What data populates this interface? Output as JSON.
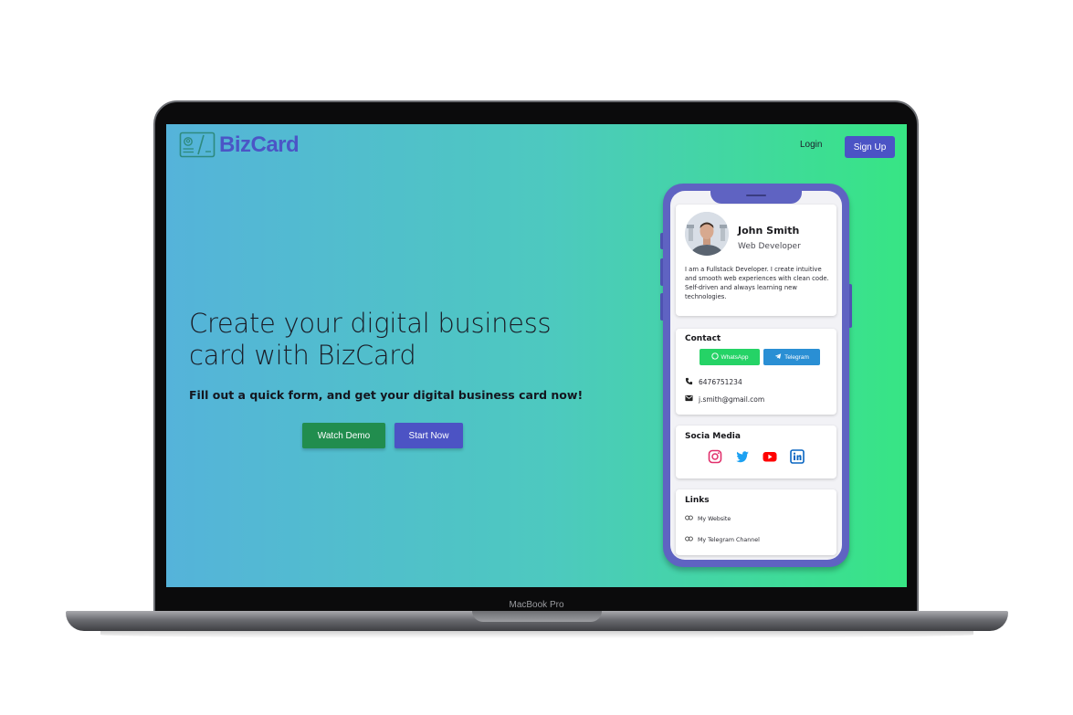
{
  "app": {
    "brand": "BizCard",
    "nav": {
      "login": "Login",
      "signup": "Sign Up"
    }
  },
  "hero": {
    "title": "Create your digital business card with BizCard",
    "subtitle": "Fill out a quick form, and get your digital business card now!",
    "watch_demo": "Watch Demo",
    "start_now": "Start Now"
  },
  "card_preview": {
    "name": "John Smith",
    "role": "Web Developer",
    "bio": "I am a Fullstack Developer. I create intuitive and smooth web experiences with clean code. Self-driven and always learning new technologies.",
    "contact": {
      "title": "Contact",
      "whatsapp": "WhatsApp",
      "telegram": "Telegram",
      "phone": "6476751234",
      "email": "j.smith@gmail.com"
    },
    "social": {
      "title": "Socia Media",
      "icons": [
        "instagram-icon",
        "twitter-icon",
        "youtube-icon",
        "linkedin-icon"
      ]
    },
    "links": {
      "title": "Links",
      "items": [
        "My Website",
        "My Telegram Channel"
      ]
    }
  },
  "device": {
    "label": "MacBook Pro"
  },
  "colors": {
    "brand": "#4b55c6",
    "demo_button": "#218d4e",
    "start_button": "#4c53c4",
    "whatsapp": "#25d366",
    "telegram": "#2a8fd4",
    "phone_frame": "#5f63c2",
    "gradient_start": "#55b3da",
    "gradient_end": "#37e584"
  }
}
